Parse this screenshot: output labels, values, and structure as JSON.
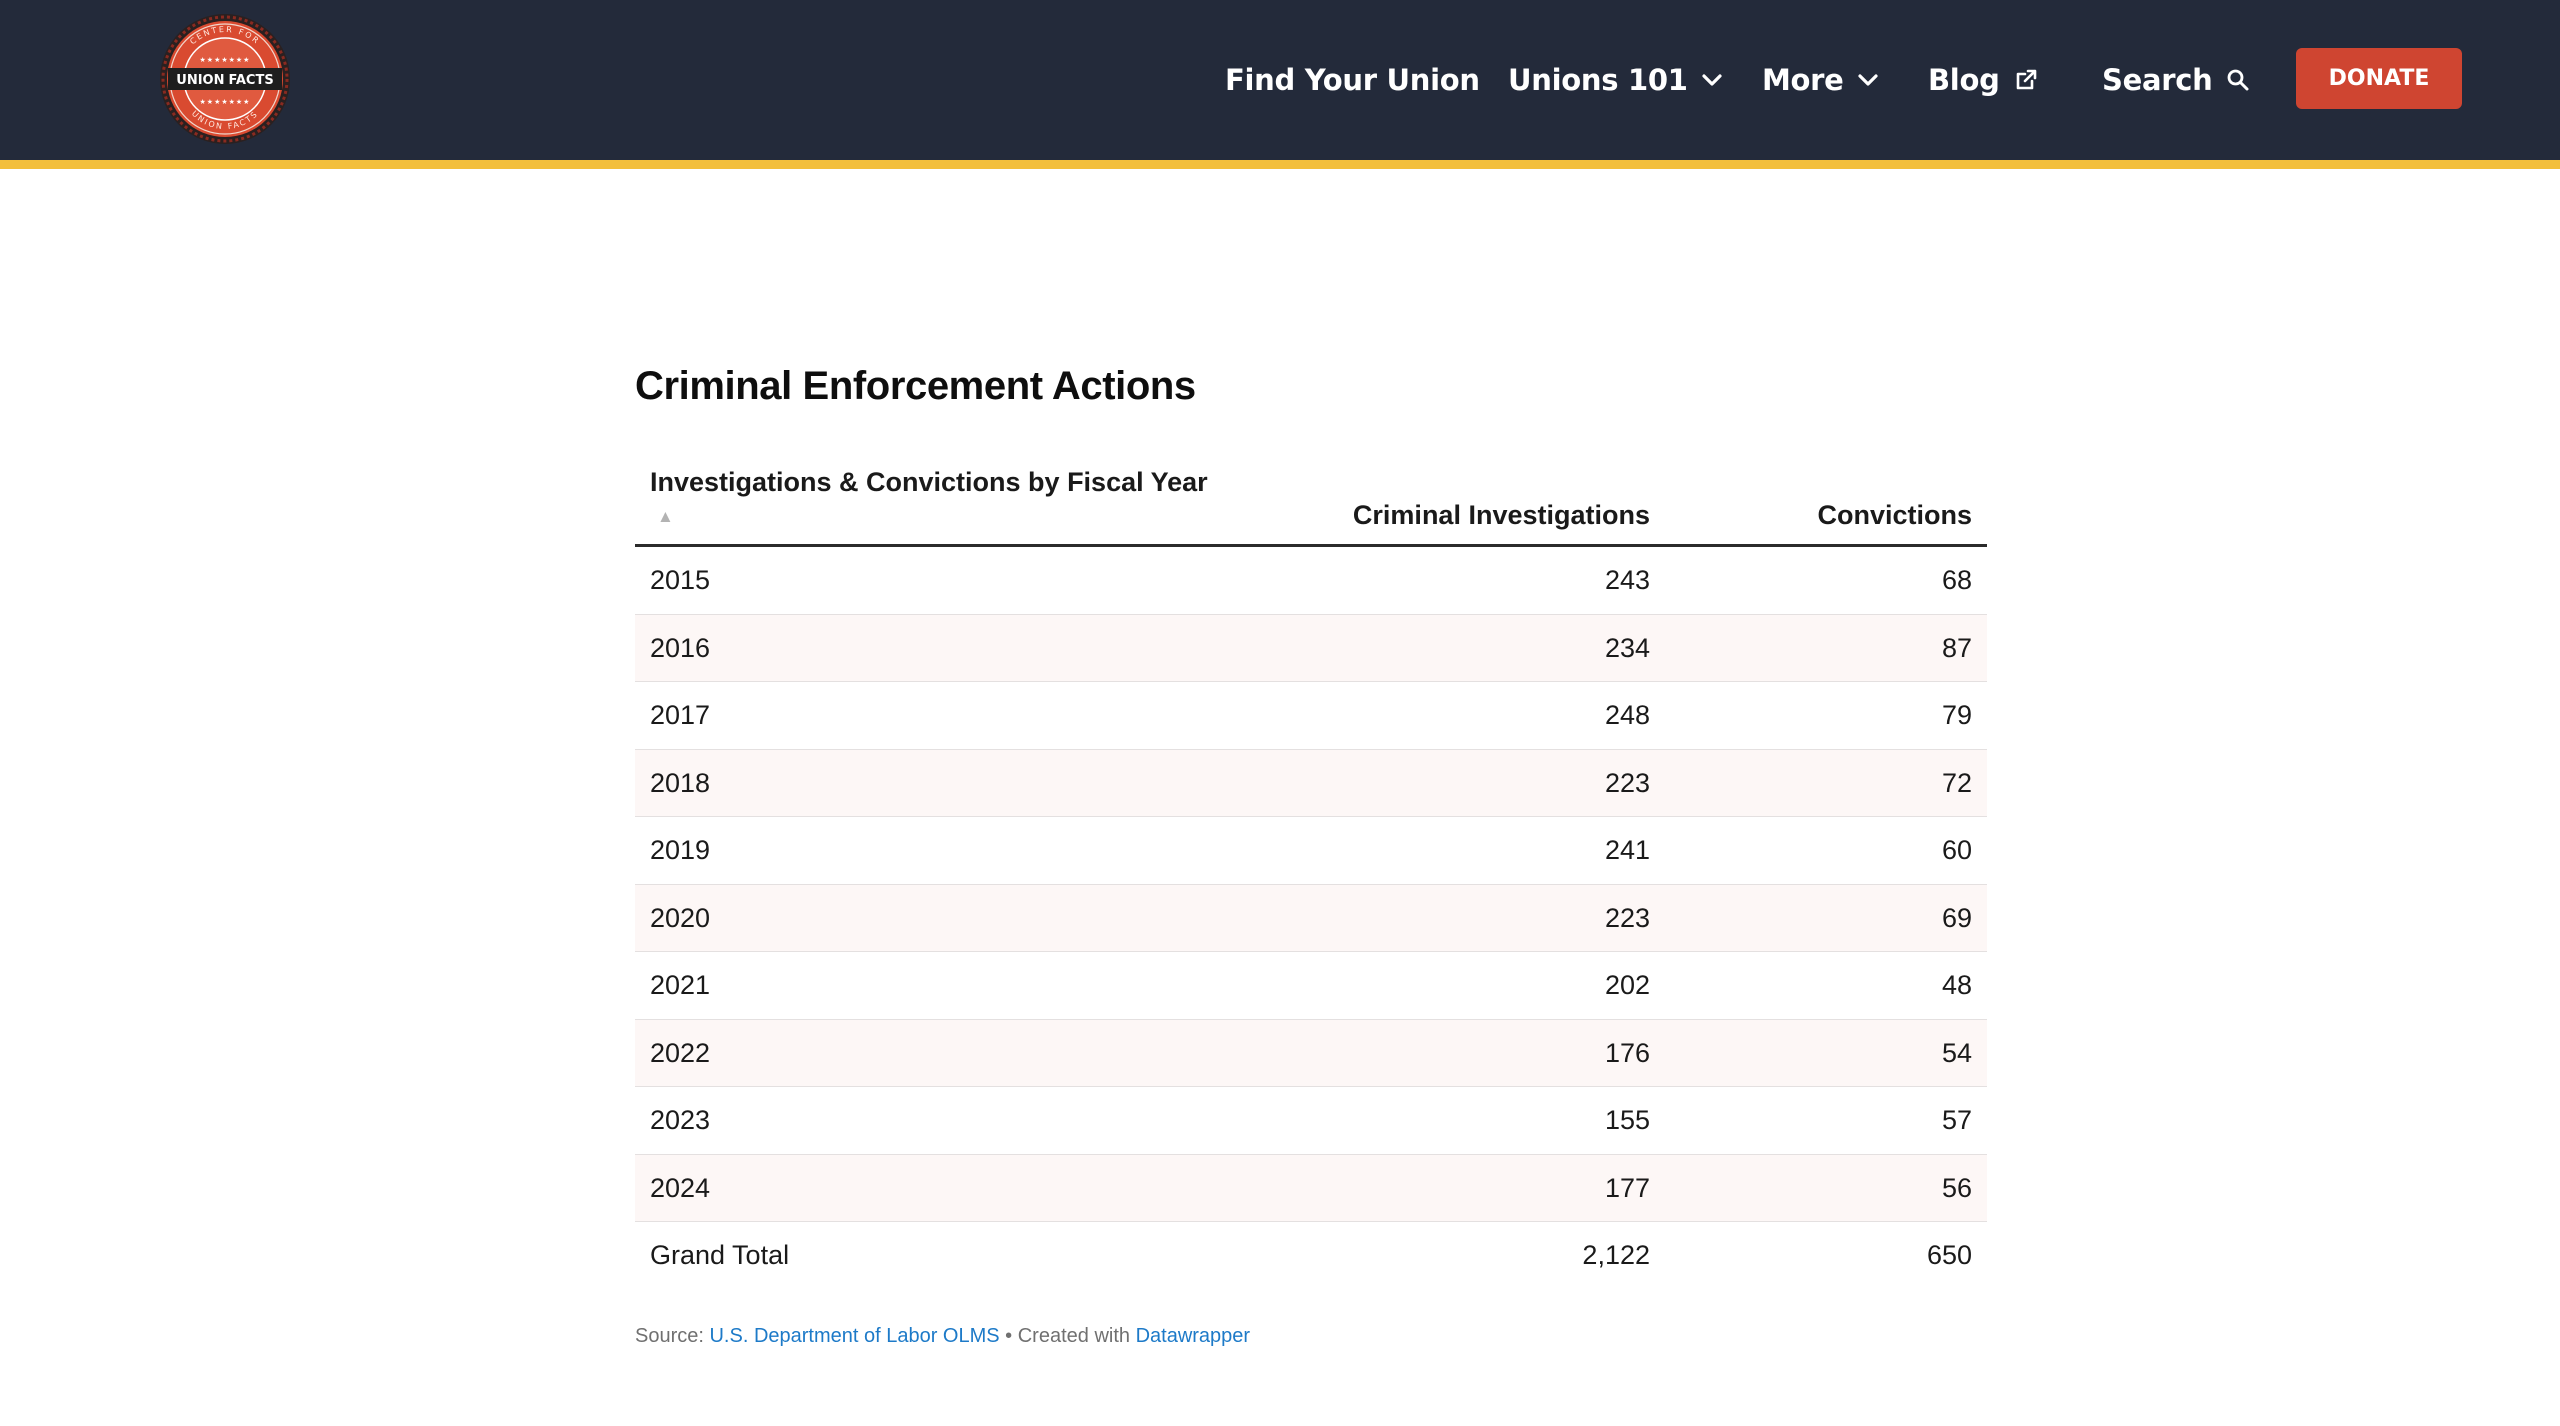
{
  "header": {
    "logo": {
      "text_union": "UNION",
      "text_facts": "FACTS",
      "ring_text_top": "CENTER FOR",
      "ring_text_bottom": "UNION FACTS",
      "colors": {
        "ring": "#d94a30",
        "band": "#1e1e1e",
        "stars": "#ffffff"
      }
    },
    "nav": {
      "find_your_union": "Find Your Union",
      "unions_101": "Unions 101",
      "more": "More",
      "blog": "Blog",
      "search": "Search"
    },
    "donate_label": "DONATE",
    "colors": {
      "background": "#232a3a",
      "stripe": "#f3bf3b",
      "donate": "#cf4531"
    }
  },
  "chart": {
    "title": "Criminal Enforcement Actions",
    "columns": {
      "year": "Investigations & Convictions by Fiscal Year",
      "investigations": "Criminal Investigations",
      "convictions": "Convictions"
    },
    "sort_indicator": "▲",
    "rows": [
      {
        "year": "2015",
        "investigations": "243",
        "convictions": "68"
      },
      {
        "year": "2016",
        "investigations": "234",
        "convictions": "87"
      },
      {
        "year": "2017",
        "investigations": "248",
        "convictions": "79"
      },
      {
        "year": "2018",
        "investigations": "223",
        "convictions": "72"
      },
      {
        "year": "2019",
        "investigations": "241",
        "convictions": "60"
      },
      {
        "year": "2020",
        "investigations": "223",
        "convictions": "69"
      },
      {
        "year": "2021",
        "investigations": "202",
        "convictions": "48"
      },
      {
        "year": "2022",
        "investigations": "176",
        "convictions": "54"
      },
      {
        "year": "2023",
        "investigations": "155",
        "convictions": "57"
      },
      {
        "year": "2024",
        "investigations": "177",
        "convictions": "56"
      }
    ],
    "total": {
      "year": "Grand Total",
      "investigations": "2,122",
      "convictions": "650"
    },
    "footer": {
      "source_prefix": "Source: ",
      "source_link": "U.S. Department of Labor OLMS",
      "created_prefix": " • Created with ",
      "created_link": "Datawrapper"
    }
  }
}
